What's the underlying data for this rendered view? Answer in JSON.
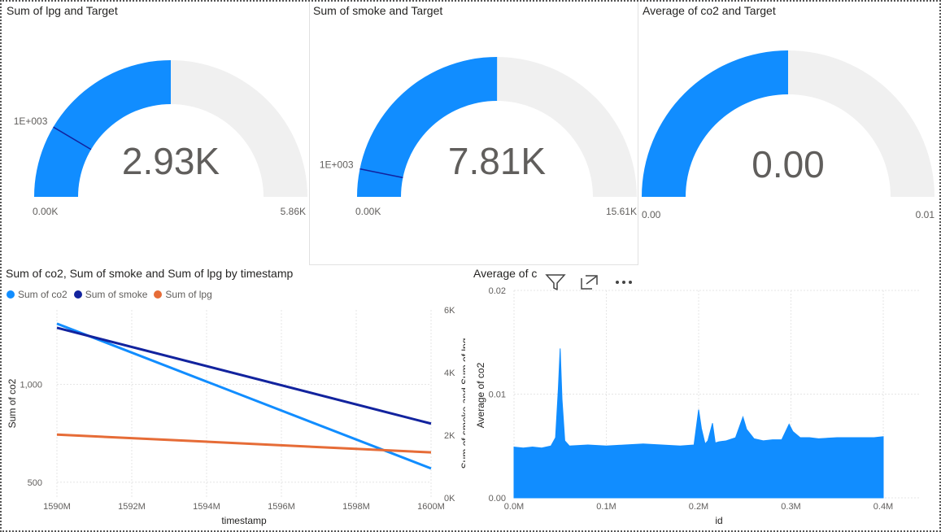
{
  "colors": {
    "blue": "#118DFF",
    "navy": "#12239E",
    "orange": "#E66C37",
    "track": "#F0F0F0",
    "target": "#12239E"
  },
  "gauges": [
    {
      "title": "Sum of lpg and Target",
      "value_label": "2.93K",
      "value": 2930,
      "min": 0,
      "max": 5860,
      "min_label": "0.00K",
      "max_label": "5.86K",
      "target": 1000,
      "target_label": "1E+003"
    },
    {
      "title": "Sum of smoke and Target",
      "value_label": "7.81K",
      "value": 7810,
      "min": 0,
      "max": 15610,
      "min_label": "0.00K",
      "max_label": "15.61K",
      "target": 1000,
      "target_label": "1E+003"
    },
    {
      "title": "Average of co2 and Target",
      "value_label": "0.00",
      "value": 0.5,
      "min": 0,
      "max": 1,
      "min_label": "0.00",
      "max_label": "0.01"
    }
  ],
  "line_visual": {
    "title": "Sum of co2, Sum of smoke and Sum of lpg by timestamp"
  },
  "area_visual": {
    "title": "Average of c"
  },
  "chart_data": [
    {
      "type": "line",
      "title": "Sum of co2, Sum of smoke and Sum of lpg by timestamp",
      "xlabel": "timestamp",
      "ylabel": "Sum of co2",
      "y2label": "Sum of smoke and Sum of lpg",
      "x_ticks": [
        "1590M",
        "1592M",
        "1594M",
        "1596M",
        "1598M",
        "1600M"
      ],
      "x_range": [
        1590,
        1600
      ],
      "y_ticks": [
        "500",
        "1,000"
      ],
      "y_range": [
        420,
        1380
      ],
      "y2_ticks": [
        "0K",
        "2K",
        "4K",
        "6K"
      ],
      "y2_range": [
        0,
        6000
      ],
      "legend_position": "top-left",
      "series": [
        {
          "name": "Sum of co2",
          "axis": "y",
          "x": [
            1590,
            1600
          ],
          "y": [
            1310,
            570
          ]
        },
        {
          "name": "Sum of smoke",
          "axis": "y2",
          "x": [
            1590,
            1600
          ],
          "y": [
            5430,
            2370
          ]
        },
        {
          "name": "Sum of lpg",
          "axis": "y2",
          "x": [
            1590,
            1600
          ],
          "y": [
            2020,
            1450
          ]
        }
      ]
    },
    {
      "type": "area",
      "title": "Average of c",
      "xlabel": "id",
      "ylabel": "Average of co2",
      "x_ticks": [
        "0.0M",
        "0.1M",
        "0.2M",
        "0.3M",
        "0.4M"
      ],
      "x_range": [
        0,
        0.4
      ],
      "y_ticks": [
        "0.00",
        "0.01",
        "0.02"
      ],
      "y_range": [
        0,
        0.02
      ],
      "series": [
        {
          "name": "Average of co2",
          "x": [
            0,
            0.01,
            0.02,
            0.03,
            0.04,
            0.045,
            0.048,
            0.05,
            0.052,
            0.055,
            0.06,
            0.08,
            0.1,
            0.12,
            0.14,
            0.16,
            0.18,
            0.195,
            0.2,
            0.203,
            0.207,
            0.21,
            0.215,
            0.218,
            0.222,
            0.23,
            0.24,
            0.248,
            0.252,
            0.26,
            0.27,
            0.28,
            0.29,
            0.298,
            0.302,
            0.31,
            0.32,
            0.33,
            0.35,
            0.37,
            0.39,
            0.4
          ],
          "y": [
            0.0049,
            0.0048,
            0.0049,
            0.0048,
            0.005,
            0.0058,
            0.0105,
            0.0144,
            0.0095,
            0.0055,
            0.005,
            0.0051,
            0.005,
            0.0051,
            0.0052,
            0.0051,
            0.005,
            0.0051,
            0.0085,
            0.0067,
            0.0052,
            0.0055,
            0.0072,
            0.0053,
            0.0054,
            0.0055,
            0.0058,
            0.0078,
            0.0066,
            0.0057,
            0.0055,
            0.0056,
            0.0056,
            0.0071,
            0.0064,
            0.0058,
            0.0058,
            0.0057,
            0.0058,
            0.0058,
            0.0058,
            0.0059
          ]
        }
      ]
    }
  ]
}
